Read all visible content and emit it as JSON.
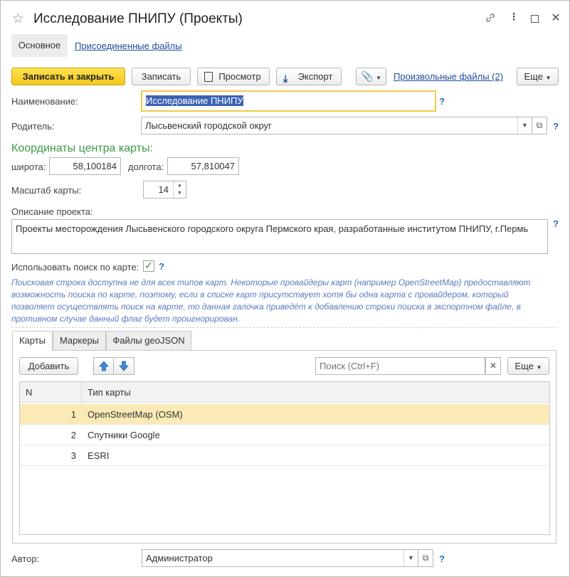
{
  "window": {
    "title": "Исследование ПНИПУ (Проекты)",
    "icons": [
      "link-icon",
      "more-vert-icon",
      "maximize-icon",
      "close-icon"
    ]
  },
  "form_tabs": {
    "main": "Основное",
    "attached": "Присоединенные файлы"
  },
  "toolbar": {
    "save_close": "Записать и закрыть",
    "save": "Записать",
    "preview": "Просмотр",
    "export": "Экспорт",
    "free_files": "Произвольные файлы (2)",
    "more": "Еще"
  },
  "fields": {
    "name_label": "Наименование:",
    "name_value": "Исследование ПНИПУ",
    "parent_label": "Родитель:",
    "parent_value": "Лысьвенский городской округ",
    "coords_title": "Координаты центра карты:",
    "lat_label": "широта:",
    "lat_value": "58,100184",
    "lon_label": "долгота:",
    "lon_value": "57,810047",
    "scale_label": "Масштаб карты:",
    "scale_value": "14",
    "desc_label": "Описание проекта:",
    "desc_value": "Проекты месторождения Лысьвенского городского округа Пермского края, разработанные институтом ПНИПУ, г.Пермь",
    "search_label": "Использовать поиск по карте:",
    "search_checked": true,
    "hint": "Поисковая строка доступна не для всех типов карт. Некоторые провайдеры карт (например OpenStreetMap) предоставляют возможность поиска по карте, поэтому, если в списке карт присутствует хотя бы одна карта с провайдером, который позволяет осуществлять поиск на карте, то данная галочка приведёт к добавлению строки поиска в экспортном файле, в противном случае данный флаг будет проигнорирован.",
    "author_label": "Автор:",
    "author_value": "Администратор",
    "q": "?"
  },
  "inner_tabs": [
    "Карты",
    "Маркеры",
    "Файлы geoJSON"
  ],
  "maps_toolbar": {
    "add": "Добавить",
    "search_placeholder": "Поиск (Ctrl+F)",
    "more": "Еще"
  },
  "table": {
    "headers": [
      "N",
      "Тип карты"
    ],
    "rows": [
      {
        "n": "1",
        "type": "OpenStreetMap (OSM)"
      },
      {
        "n": "2",
        "type": "Спутники Google"
      },
      {
        "n": "3",
        "type": "ESRI"
      }
    ]
  },
  "colors": {
    "accent_green": "#3c9a47",
    "primary_yellow": "#f4c61b",
    "link_blue": "#1f4b9d",
    "selected_row": "#fbeab6"
  }
}
